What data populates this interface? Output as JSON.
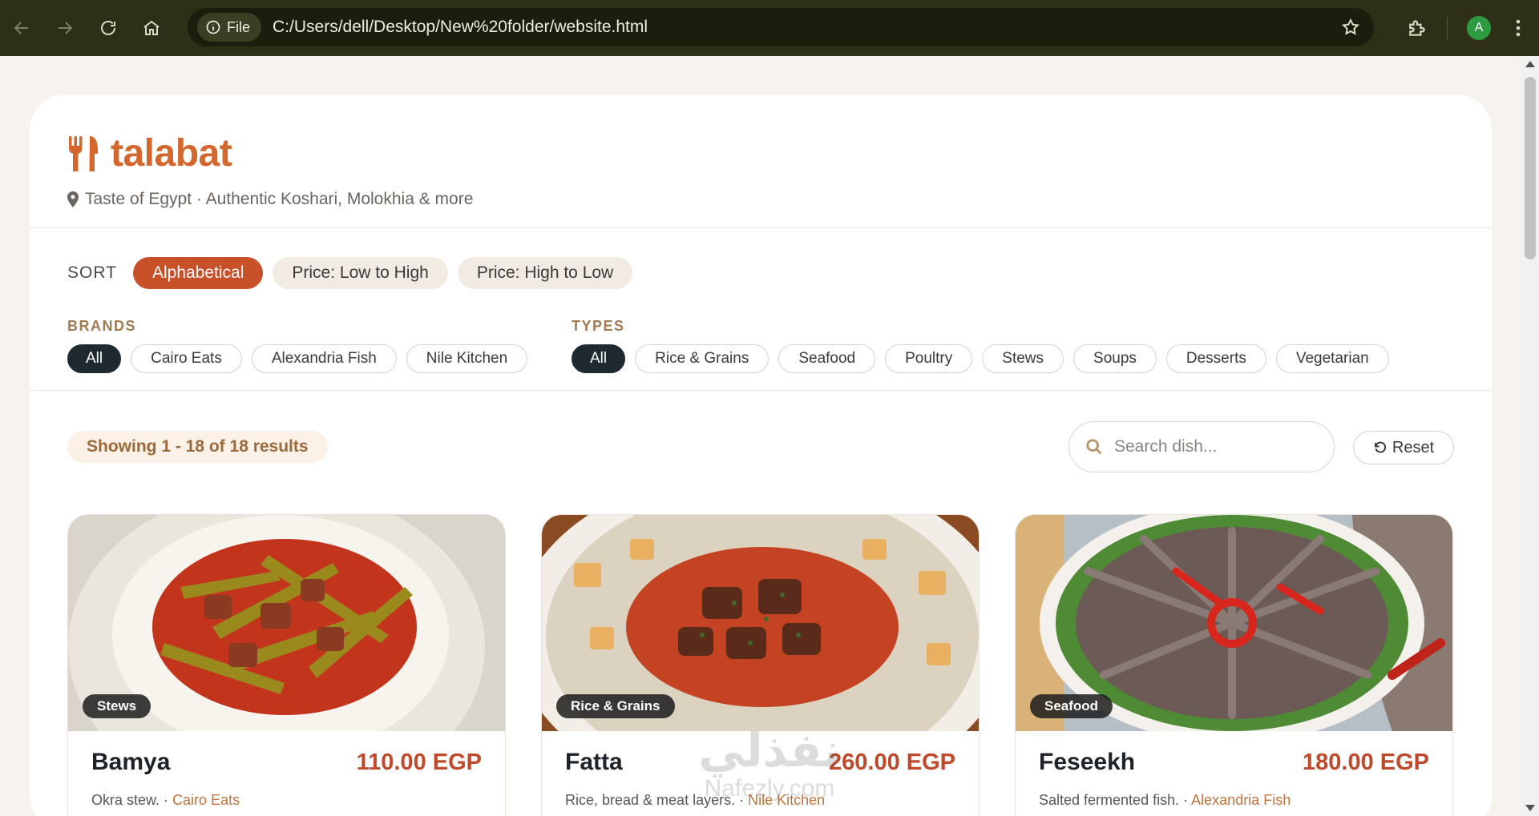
{
  "browser": {
    "url_chip": "File",
    "url": "C:/Users/dell/Desktop/New%20folder/website.html",
    "profile_initial": "A"
  },
  "header": {
    "brand": "talabat",
    "tagline": "Taste of Egypt · Authentic Koshari, Molokhia & more"
  },
  "sort": {
    "label": "SORT",
    "options": [
      "Alphabetical",
      "Price: Low to High",
      "Price: High to Low"
    ],
    "active": "Alphabetical"
  },
  "brands": {
    "label": "BRANDS",
    "options": [
      "All",
      "Cairo Eats",
      "Alexandria Fish",
      "Nile Kitchen"
    ],
    "active": "All"
  },
  "types": {
    "label": "TYPES",
    "options": [
      "All",
      "Rice & Grains",
      "Seafood",
      "Poultry",
      "Stews",
      "Soups",
      "Desserts",
      "Vegetarian"
    ],
    "active": "All"
  },
  "results": {
    "summary": "Showing 1 - 18 of 18 results",
    "search_placeholder": "Search dish...",
    "reset_label": "Reset"
  },
  "products": [
    {
      "name": "Bamya",
      "price": "110.00 EGP",
      "description": "Okra stew.",
      "brand": "Cairo Eats",
      "type": "Stews"
    },
    {
      "name": "Fatta",
      "price": "260.00 EGP",
      "description": "Rice, bread & meat layers.",
      "brand": "Nile Kitchen",
      "type": "Rice & Grains"
    },
    {
      "name": "Feseekh",
      "price": "180.00 EGP",
      "description": "Salted fermented fish.",
      "brand": "Alexandria Fish",
      "type": "Seafood"
    }
  ],
  "watermark": {
    "arabic": "نفذلي",
    "latin": "Nafezly.com"
  },
  "colors": {
    "accent": "#d4672d",
    "active_sort": "#c8512a",
    "active_chip": "#1e2a30",
    "price": "#c0492b"
  }
}
